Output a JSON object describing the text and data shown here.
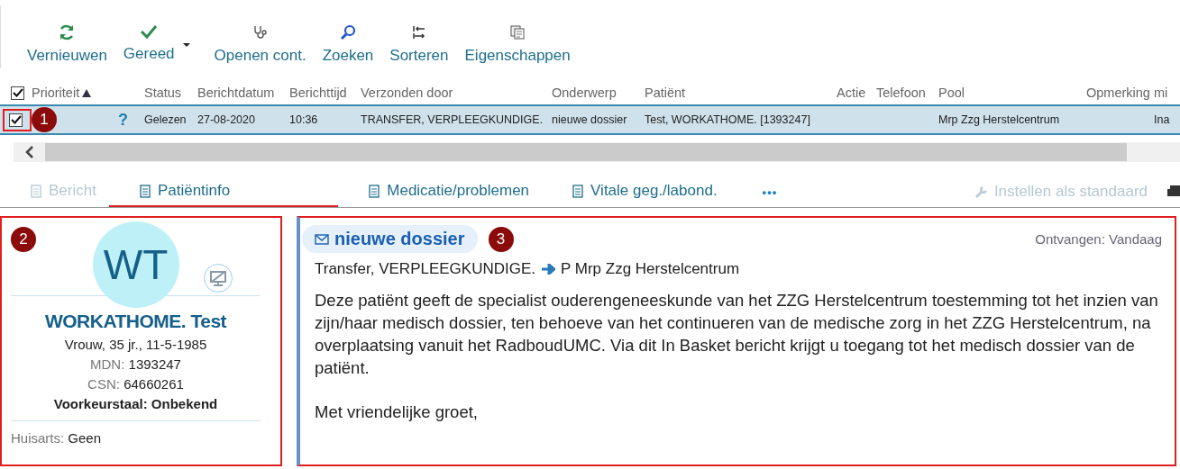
{
  "toolbar": [
    {
      "label": "Vernieuwen",
      "kind": "refresh",
      "dropdown": false
    },
    {
      "label": "Gereed",
      "kind": "done",
      "dropdown": true
    },
    {
      "label": "Openen cont.",
      "kind": "stethoscope",
      "dropdown": false
    },
    {
      "label": "Zoeken",
      "kind": "search",
      "dropdown": false
    },
    {
      "label": "Sorteren",
      "kind": "sort",
      "dropdown": false
    },
    {
      "label": "Eigenschappen",
      "kind": "properties",
      "dropdown": false
    }
  ],
  "table": {
    "all_checked": true,
    "columns": [
      {
        "label": "Prioriteit",
        "sorted": true
      },
      {
        "label": "Status",
        "sorted": false
      },
      {
        "label": "Berichtdatum",
        "sorted": false
      },
      {
        "label": "Berichttijd",
        "sorted": false
      },
      {
        "label": "Verzonden door",
        "sorted": false
      },
      {
        "label": "Onderwerp",
        "sorted": false
      },
      {
        "label": "Patiënt",
        "sorted": false
      },
      {
        "label": "Actie",
        "sorted": false
      },
      {
        "label": "Telefoon",
        "sorted": false
      },
      {
        "label": "Pool",
        "sorted": false
      },
      {
        "label": "Opmerking",
        "sorted": false
      },
      {
        "label": "mi",
        "sorted": false
      }
    ],
    "rows": [
      {
        "checked": true,
        "selected": true,
        "annotation": "1",
        "priority": "?",
        "status": "Gelezen",
        "date": "27-08-2020",
        "time": "10:36",
        "sender": "TRANSFER, VERPLEEGKUNDIGE.",
        "subject": "nieuwe dossier",
        "patient": "Test, WORKATHOME. [1393247]",
        "pool": "Mrp Zzg Herstelcentrum",
        "column_12": "Ina"
      }
    ]
  },
  "tabs": [
    {
      "label": "Bericht",
      "selected": false,
      "disabled": true
    },
    {
      "label": "Patiëntinfo",
      "selected": true,
      "disabled": false
    },
    {
      "label": "Medicatie/problemen",
      "selected": false,
      "disabled": false
    },
    {
      "label": "Vitale geg./labond.",
      "selected": false,
      "disabled": false
    }
  ],
  "more": "•••",
  "default_action": {
    "label": "Instellen als standaard",
    "disabled": true
  },
  "patient": {
    "annotation": "2",
    "initials": "WT",
    "name": "WORKATHOME. Test",
    "details": "Vrouw, 35 jr., 11-5-1985",
    "fields": [
      {
        "label": "MDN:",
        "value": "1393247"
      },
      {
        "label": "CSN:",
        "value": "64660261"
      }
    ],
    "language": "Voorkeurstaal: Onbekend",
    "gp_label": "Huisarts:",
    "gp_value": "Geen"
  },
  "message": {
    "subject": "nieuwe dossier",
    "annotation": "3",
    "received": "Ontvangen: Vandaag",
    "from": "Transfer, VERPLEEGKUNDIGE.",
    "to": "P Mrp Zzg Herstelcentrum",
    "paragraphs": [
      "Deze patiënt geeft de specialist ouderengeneeskunde van het ZZG Herstelcentrum toestemming tot het inzien van zijn/haar medisch dossier, ten behoeve van het continueren van de medische zorg in het ZZG Herstelcentrum, na overplaatsing vanuit het RadboudUMC. Via dit In Basket bericht krijgt u toegang tot het medisch dossier van de patiënt.",
      "Met vriendelijke groet,"
    ]
  }
}
